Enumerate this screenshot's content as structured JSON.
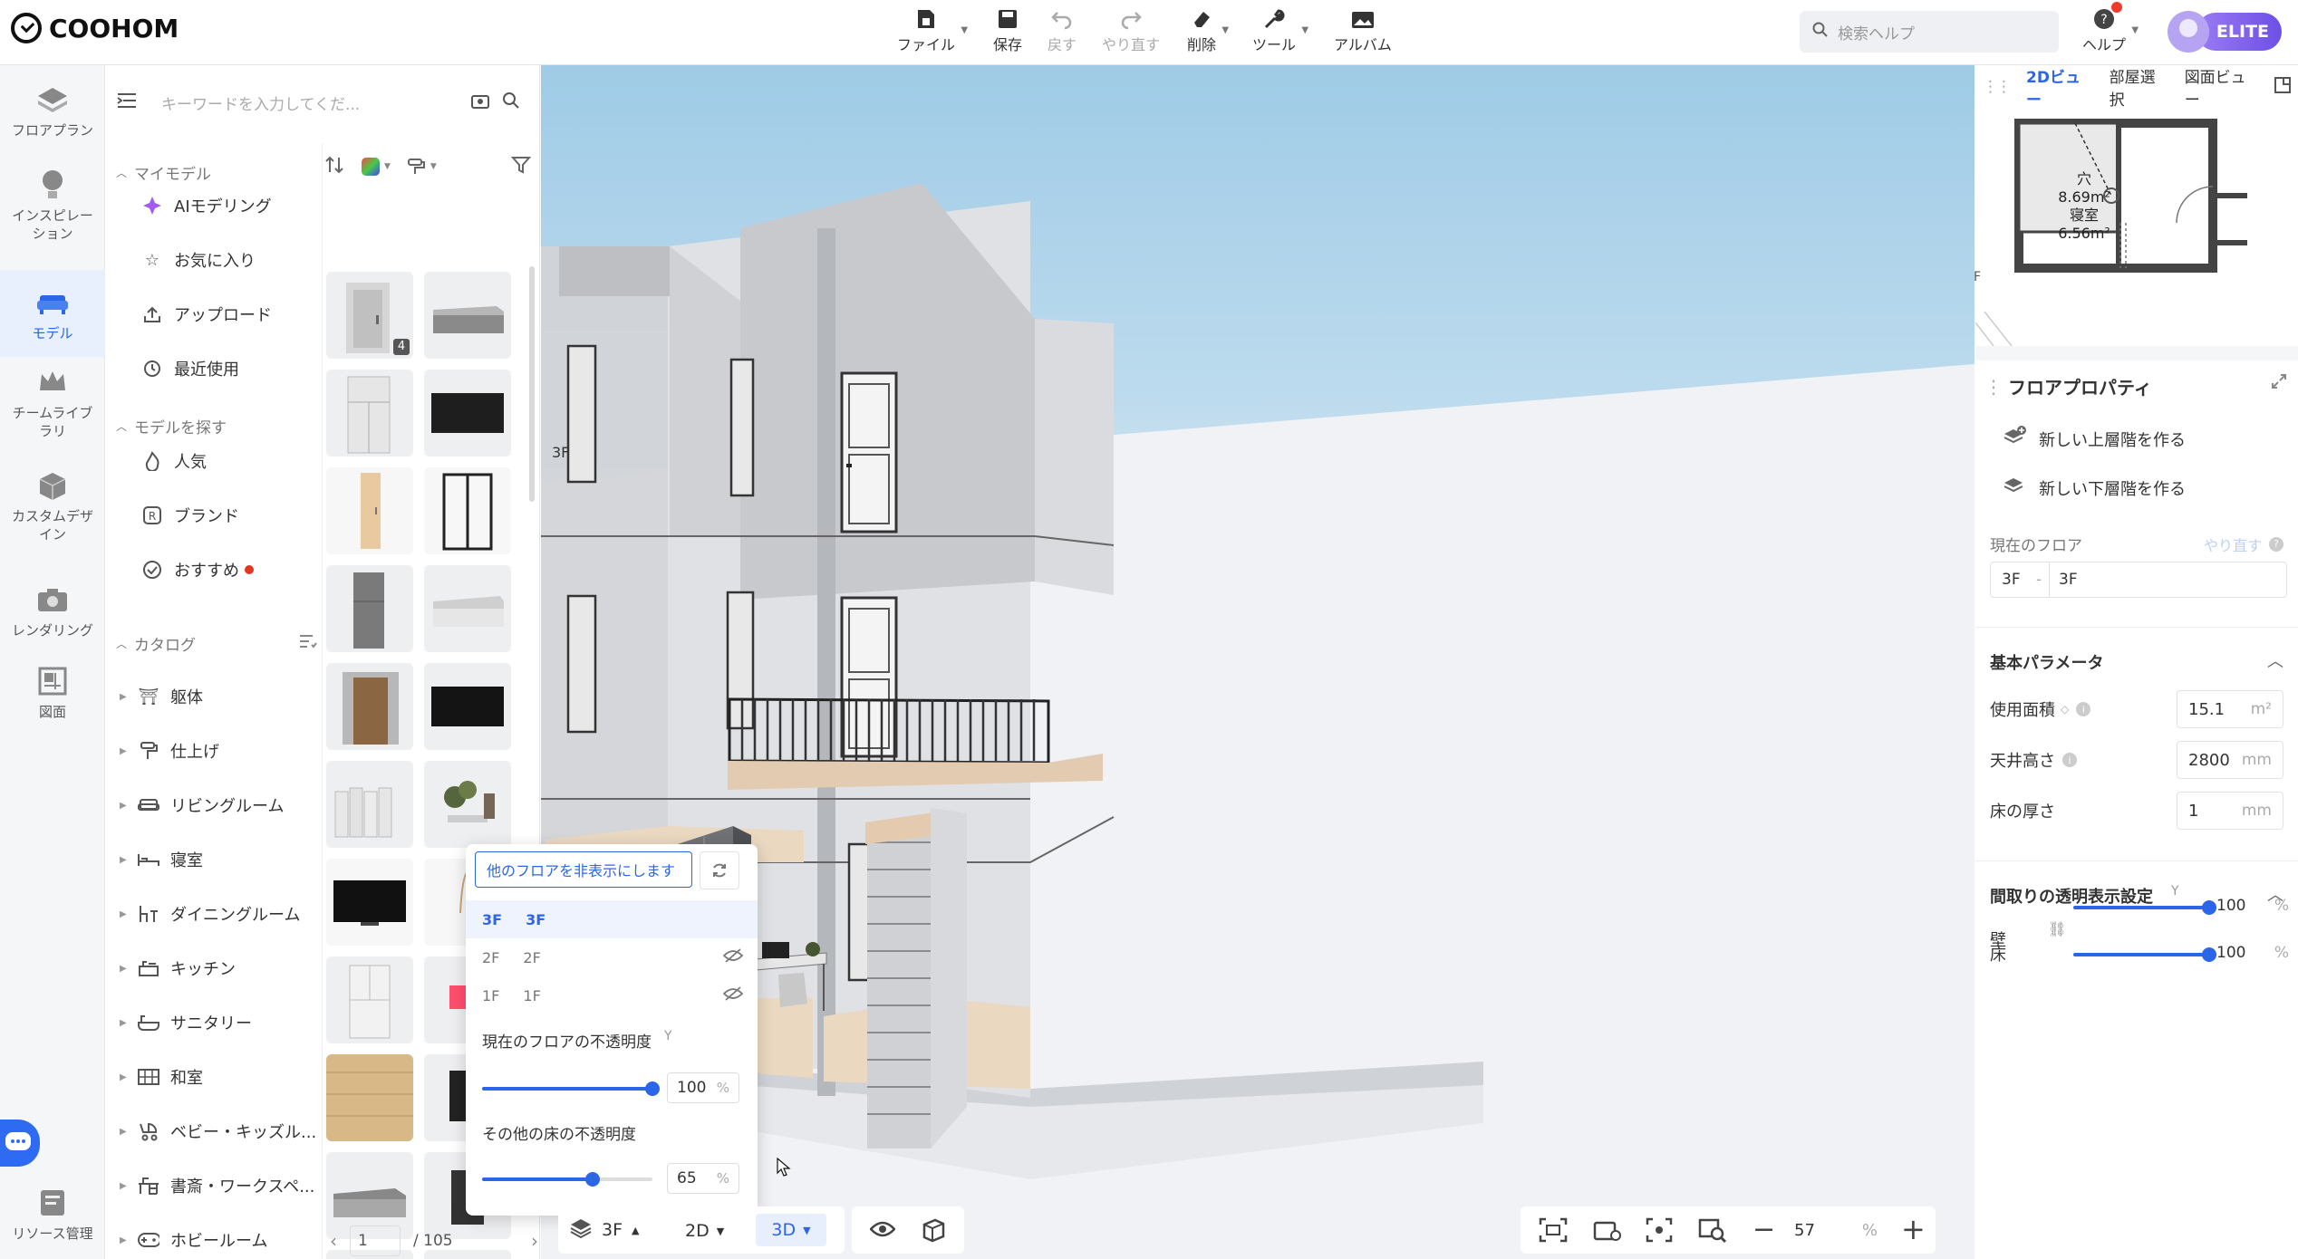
{
  "brand": {
    "name": "COOHOM"
  },
  "toolbar": {
    "file": "ファイル",
    "save": "保存",
    "undo": "戻す",
    "redo": "やり直す",
    "delete": "削除",
    "tools": "ツール",
    "album": "アルバム"
  },
  "help_search": {
    "placeholder": "検索ヘルプ"
  },
  "help": {
    "label": "ヘルプ"
  },
  "user": {
    "badge": "ELITE"
  },
  "rail": [
    {
      "label": "フロアプラン",
      "icon": "floorplan-icon"
    },
    {
      "label": "インスピレーション",
      "icon": "lightbulb-icon"
    },
    {
      "label": "モデル",
      "icon": "sofa-icon"
    },
    {
      "label": "チームライブラリ",
      "icon": "crown-icon"
    },
    {
      "label": "カスタムデザイン",
      "icon": "box-icon"
    },
    {
      "label": "レンダリング",
      "icon": "camera-icon"
    },
    {
      "label": "図面",
      "icon": "drawing-icon"
    },
    {
      "label": "リソース管理",
      "icon": "resource-icon"
    }
  ],
  "panel": {
    "search_placeholder": "キーワードを入力してくだ...",
    "my_models": "マイモデル",
    "my_items": [
      "AIモデリング",
      "お気に入り",
      "アップロード",
      "最近使用"
    ],
    "find_models": "モデルを探す",
    "find_items": [
      "人気",
      "ブランド",
      "おすすめ"
    ],
    "catalog": "カタログ",
    "catalog_items": [
      "躯体",
      "仕上げ",
      "リビングルーム",
      "寝室",
      "ダイニングルーム",
      "キッチン",
      "サニタリー",
      "和室",
      "ベビー・キッズル...",
      "書斎・ワークスペ...",
      "ホビールーム"
    ],
    "thumb_badge": "4",
    "pager": {
      "current": "1",
      "total": "/ 105"
    }
  },
  "viewport": {
    "floor_label": "3F"
  },
  "floor_popup": {
    "hide_button": "他のフロアを非表示にします",
    "floors": [
      {
        "code": "3F",
        "name": "3F"
      },
      {
        "code": "2F",
        "name": "2F"
      },
      {
        "code": "1F",
        "name": "1F"
      }
    ],
    "current_opacity_label": "現在のフロアの不透明度",
    "current_opacity": "100",
    "other_opacity_label": "その他の床の不透明度",
    "other_opacity": "65",
    "unit": "%"
  },
  "bottom": {
    "floor": "3F",
    "view2d": "2D",
    "view3d": "3D",
    "zoom": "57",
    "zoom_unit": "%"
  },
  "minimap": {
    "tabs": [
      "2Dビュー",
      "部屋選択",
      "図面ビュー"
    ],
    "room_label1": "穴",
    "area1": "8.69m²",
    "room_label2": "寝室",
    "area2": "6.56m²",
    "marker": "F"
  },
  "props": {
    "title": "フロアプロパティ",
    "new_upper": "新しい上層階を作る",
    "new_lower": "新しい下層階を作る",
    "current_floor": "現在のフロア",
    "redo": "やり直す",
    "floor_code": "3F",
    "floor_name": "3F",
    "basic_params": "基本パラメータ",
    "area_label": "使用面積",
    "area_value": "15.1",
    "area_unit": "m²",
    "ceiling_label": "天井高さ",
    "ceiling_value": "2800",
    "ceiling_unit": "mm",
    "floor_thk_label": "床の厚さ",
    "floor_thk_value": "1",
    "floor_thk_unit": "mm",
    "transparency_title": "間取りの透明表示設定",
    "wall_label": "壁",
    "wall_value": "100",
    "floor_label": "床",
    "floor_value": "100",
    "pct": "%"
  }
}
